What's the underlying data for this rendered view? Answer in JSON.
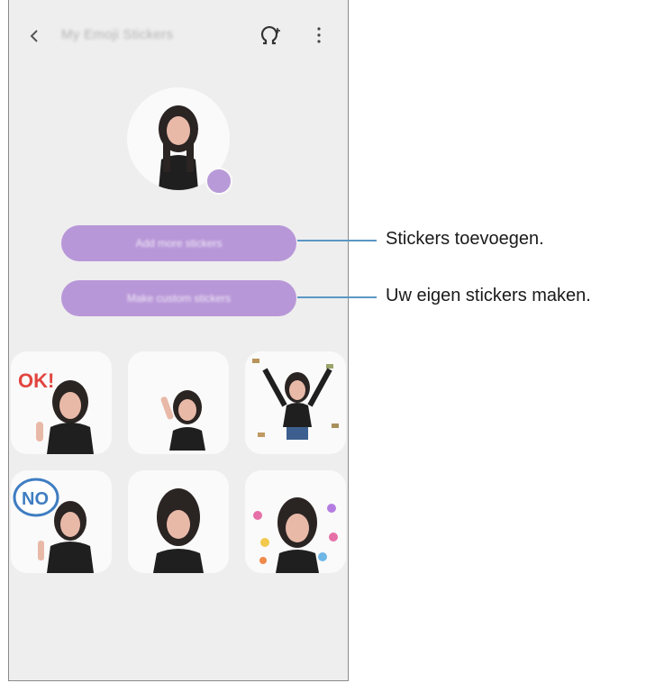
{
  "app_title": "My Emoji Stickers",
  "icons": {
    "back": "chevron-left-icon",
    "ar": "ar-emoji-plus-icon",
    "more": "more-vertical-icon"
  },
  "buttons": {
    "add_stickers": "Add more stickers",
    "make_stickers": "Make custom stickers"
  },
  "stickers": [
    {
      "label": "OK!"
    },
    {
      "label": ""
    },
    {
      "label": ""
    },
    {
      "label": "NO"
    },
    {
      "label": ""
    },
    {
      "label": ""
    }
  ],
  "callouts": [
    {
      "text": "Stickers toevoegen."
    },
    {
      "text": "Uw eigen stickers maken."
    }
  ],
  "colors": {
    "accent": "#b897d8",
    "callout_line": "#5b97c4",
    "background": "#eeeeee"
  }
}
